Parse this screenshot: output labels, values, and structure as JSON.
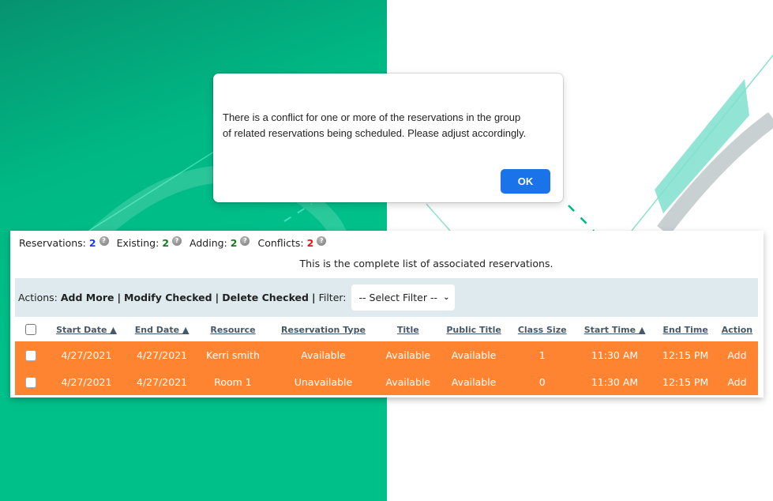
{
  "dialog": {
    "message_line1": "There is a conflict for one or more of the reservations in the group",
    "message_line2": "of related reservations being scheduled. Please adjust accordingly.",
    "ok_label": "OK"
  },
  "stats": [
    {
      "label": "Reservations:",
      "value": "2",
      "color": "#1a3cff"
    },
    {
      "label": "Existing:",
      "value": "2",
      "color": "#1a7a1a"
    },
    {
      "label": "Adding:",
      "value": "2",
      "color": "#1a7a1a"
    },
    {
      "label": "Conflicts:",
      "value": "2",
      "color": "#ee1111"
    }
  ],
  "help_icon": "question-circle-icon",
  "help_glyph": "?",
  "complete_list_text": "This is the complete list of associated reservations.",
  "actions": {
    "label": "Actions:",
    "items": [
      "Add More",
      "Modify Checked",
      "Delete Checked"
    ],
    "separator": "|",
    "filter_label": "Filter:",
    "filter_value": "-- Select Filter --",
    "filter_chevron": "⌄"
  },
  "table": {
    "columns": [
      "Start Date ▲",
      "End Date ▲",
      "Resource",
      "Reservation Type",
      "Title",
      "Public Title",
      "Class Size",
      "Start Time ▲",
      "End Time",
      "Action"
    ],
    "rows": [
      [
        "4/27/2021",
        "4/27/2021",
        "Kerri smith",
        "Available",
        "Available",
        "Available",
        "1",
        "11:30 AM",
        "12:15 PM",
        "Add"
      ],
      [
        "4/27/2021",
        "4/27/2021",
        "Room 1",
        "Unavailable",
        "Available",
        "Available",
        "0",
        "11:30 AM",
        "12:15 PM",
        "Add"
      ]
    ],
    "conflict_row_color": "#fe8432"
  },
  "colors": {
    "brand_green": "#00c08a",
    "dialog_button": "#1a73e8",
    "actions_bar": "#deeaed",
    "header_link": "#44596b"
  }
}
